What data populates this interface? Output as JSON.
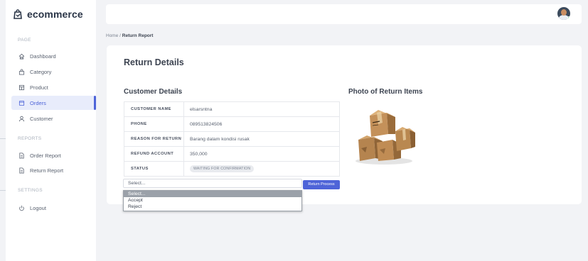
{
  "brand": {
    "name": "ecommerce"
  },
  "sidebar": {
    "sections": [
      {
        "label": "PAGE"
      },
      {
        "label": "REPORTS"
      },
      {
        "label": "SETTINGS"
      }
    ],
    "items": [
      {
        "label": "Dashboard",
        "icon": "home-icon"
      },
      {
        "label": "Category",
        "icon": "bag-icon"
      },
      {
        "label": "Product",
        "icon": "product-box-icon"
      },
      {
        "label": "Orders",
        "icon": "orders-icon",
        "active": true
      },
      {
        "label": "Customer",
        "icon": "user-icon"
      },
      {
        "label": "Order Report",
        "icon": "document-icon"
      },
      {
        "label": "Return Report",
        "icon": "document-icon"
      },
      {
        "label": "Logout",
        "icon": "power-icon"
      }
    ]
  },
  "breadcrumb": {
    "home": "Home",
    "separator": "/",
    "current": "Return Report"
  },
  "page": {
    "title": "Return Details",
    "customer_section_title": "Customer Details",
    "photo_section_title": "Photo of Return Items",
    "details": [
      {
        "key": "CUSTOMER NAME",
        "value": "elsarsntna"
      },
      {
        "key": "PHONE",
        "value": "089513824506"
      },
      {
        "key": "REASON FOR RETURN",
        "value": "Barang dalam kondisi rusak"
      },
      {
        "key": "REFUND ACCOUNT",
        "value": "350,000"
      },
      {
        "key": "STATUS",
        "value": "WAITING FOR CONFIRMATION"
      }
    ],
    "select": {
      "current": "Select...",
      "options": [
        "Select...",
        "Accept",
        "Reject"
      ]
    },
    "process_button": "Return Process"
  },
  "colors": {
    "accent": "#4e64d8",
    "background": "#f2f3f6",
    "card": "#ffffff"
  }
}
